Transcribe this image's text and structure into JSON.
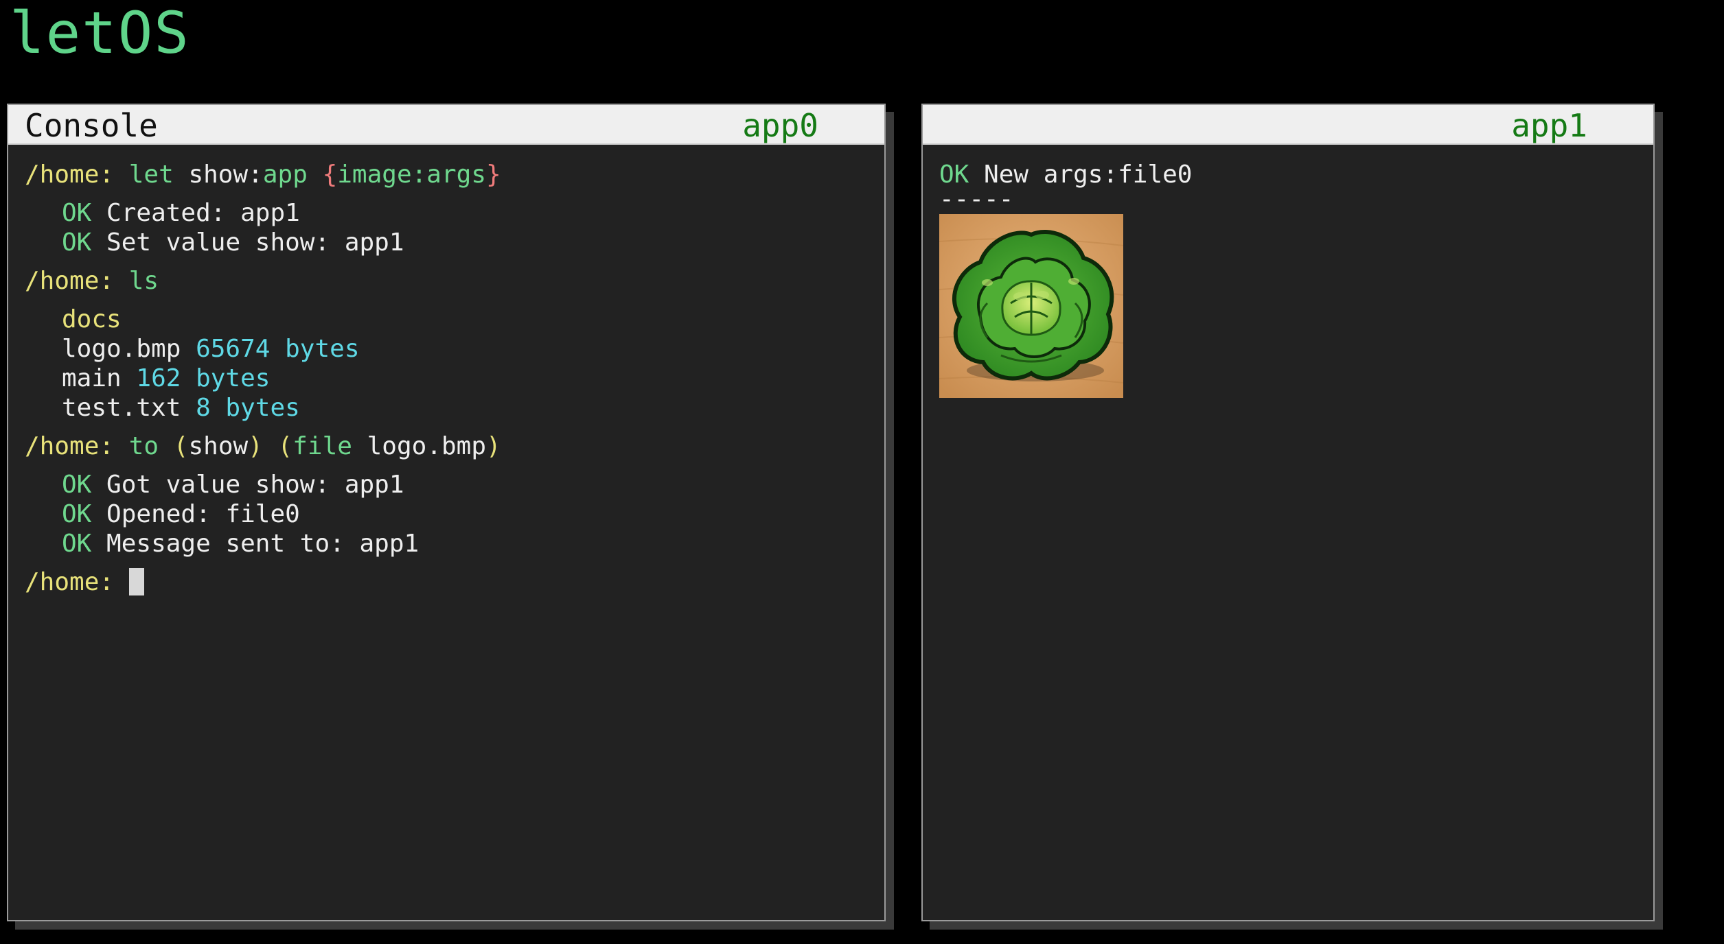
{
  "logo": "letOS",
  "windows": {
    "console": {
      "title": "Console",
      "app_label": "app0"
    },
    "viewer": {
      "title": "",
      "app_label": "app1"
    }
  },
  "console": {
    "prompt": "/home:",
    "cmd1": {
      "kw": "let",
      "name": "show",
      "colon": ":",
      "type": "app",
      "open": "{",
      "arg": "image:args",
      "close": "}"
    },
    "out1": [
      {
        "status": "OK",
        "text": "Created: app1"
      },
      {
        "status": "OK",
        "text": "Set value show: app1"
      }
    ],
    "cmd2": {
      "kw": "ls"
    },
    "listing": {
      "dir": "docs",
      "files": [
        {
          "name": "logo.bmp",
          "size": "65674 bytes"
        },
        {
          "name": "main",
          "size": "162 bytes"
        },
        {
          "name": "test.txt",
          "size": "8 bytes"
        }
      ]
    },
    "cmd3": {
      "kw": "to",
      "open1": "(",
      "arg1": "show",
      "close1": ")",
      "open2": "(",
      "kw2": "file",
      "arg2": "logo.bmp",
      "close2": ")"
    },
    "out3": [
      {
        "status": "OK",
        "text": "Got value show: app1"
      },
      {
        "status": "OK",
        "text": "Opened: file0"
      },
      {
        "status": "OK",
        "text": "Message sent to: app1"
      }
    ]
  },
  "viewer": {
    "status": "OK",
    "message": "New args:file0",
    "separator": "-----",
    "image_subject": "lettuce-image"
  },
  "colors": {
    "background": "#000000",
    "window": "#222222",
    "titlebar": "#efefef",
    "accent_green": "#6fd88e",
    "app_label_green": "#157a15",
    "prompt_yellow": "#e8e27a",
    "size_cyan": "#5fd9e6",
    "brace_red": "#ef7b7b"
  }
}
